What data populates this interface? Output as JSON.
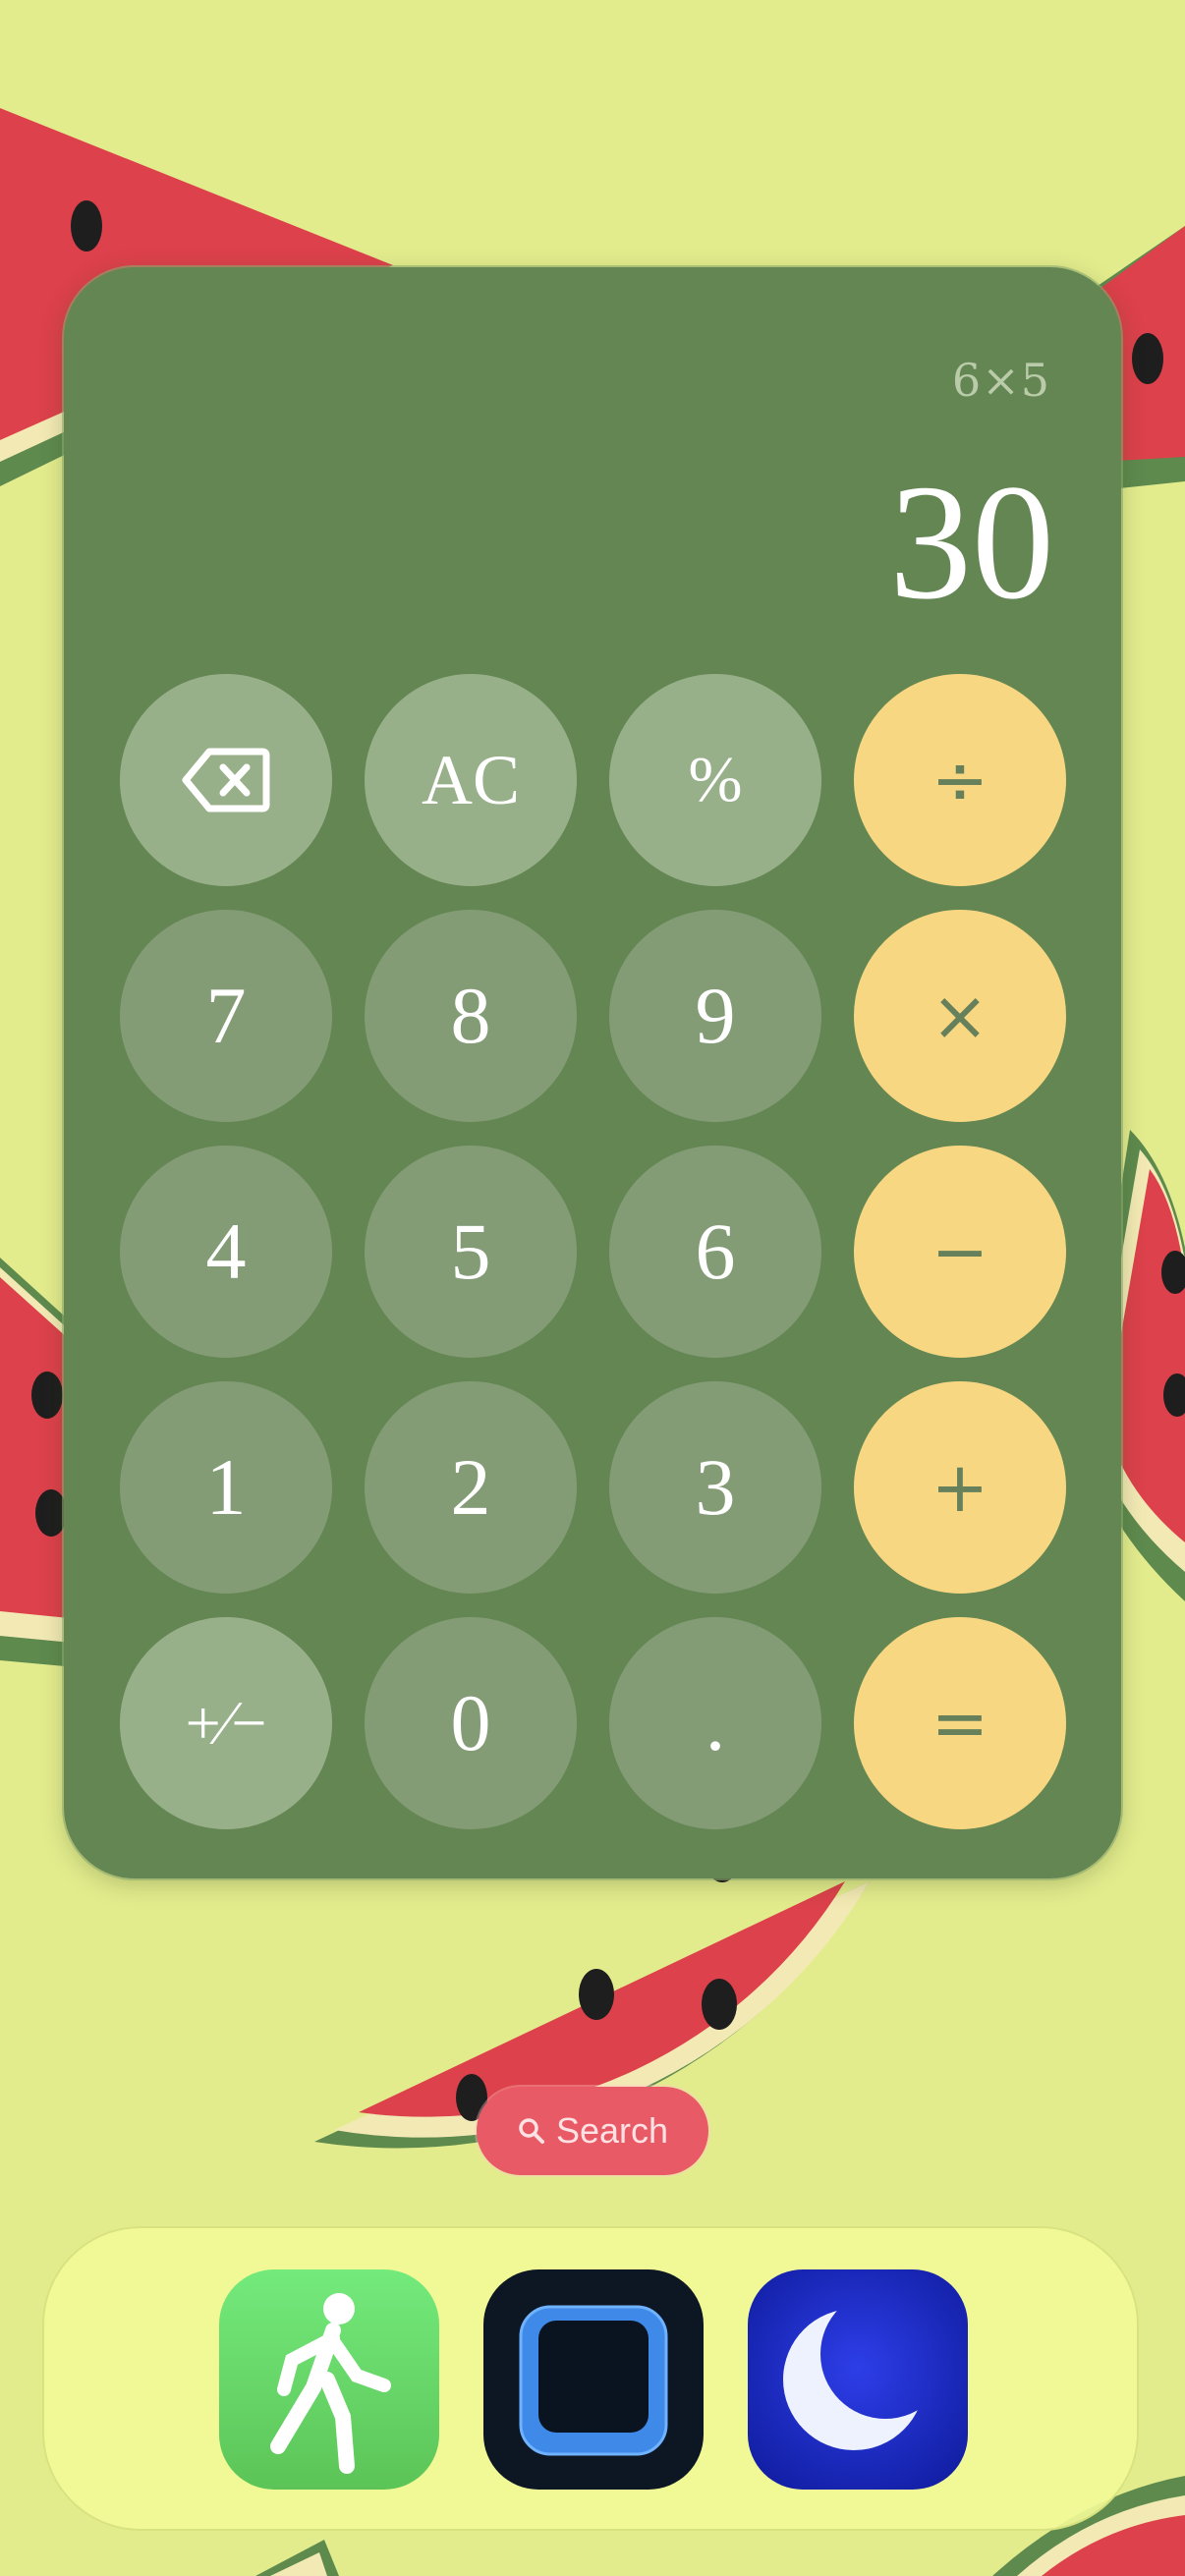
{
  "calculator": {
    "expression": "6×5",
    "result": "30",
    "keys": [
      {
        "label": "⌫",
        "type": "fn",
        "name": "backspace-key"
      },
      {
        "label": "AC",
        "type": "fn",
        "name": "all-clear-key"
      },
      {
        "label": "%",
        "type": "fn",
        "name": "percent-key"
      },
      {
        "label": "÷",
        "type": "op",
        "name": "divide-key"
      },
      {
        "label": "7",
        "type": "num",
        "name": "digit-7-key"
      },
      {
        "label": "8",
        "type": "num",
        "name": "digit-8-key"
      },
      {
        "label": "9",
        "type": "num",
        "name": "digit-9-key"
      },
      {
        "label": "×",
        "type": "op",
        "name": "multiply-key"
      },
      {
        "label": "4",
        "type": "num",
        "name": "digit-4-key"
      },
      {
        "label": "5",
        "type": "num",
        "name": "digit-5-key"
      },
      {
        "label": "6",
        "type": "num",
        "name": "digit-6-key"
      },
      {
        "label": "−",
        "type": "op",
        "name": "subtract-key"
      },
      {
        "label": "1",
        "type": "num",
        "name": "digit-1-key"
      },
      {
        "label": "2",
        "type": "num",
        "name": "digit-2-key"
      },
      {
        "label": "3",
        "type": "num",
        "name": "digit-3-key"
      },
      {
        "label": "+",
        "type": "op",
        "name": "add-key"
      },
      {
        "label": "+⁄−",
        "type": "fn",
        "name": "plus-minus-key"
      },
      {
        "label": "0",
        "type": "num",
        "name": "digit-0-key"
      },
      {
        "label": ".",
        "type": "num",
        "name": "decimal-key"
      },
      {
        "label": "=",
        "type": "op",
        "name": "equals-key"
      }
    ]
  },
  "search": {
    "label": "Search",
    "icon": "search-icon"
  },
  "dock": {
    "apps": [
      {
        "name": "fitness-walking-app",
        "icon": "walking-person-icon"
      },
      {
        "name": "blue-frame-app",
        "icon": "rounded-square-icon"
      },
      {
        "name": "sleep-moon-app",
        "icon": "crescent-moon-icon"
      }
    ]
  },
  "colors": {
    "background": "#e3ec8d",
    "widget": "#648653",
    "operator_key": "#f8d782",
    "function_key": "#98b08a",
    "number_key": "#839c76",
    "watermelon_red": "#dd414b"
  }
}
